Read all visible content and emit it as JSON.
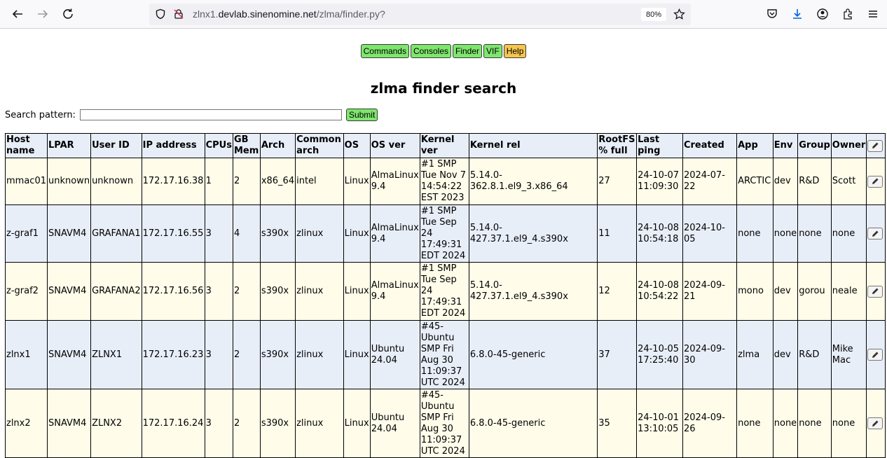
{
  "browser": {
    "url_prefix": "zlnx1.",
    "url_host": "devlab.sinenomine.net",
    "url_path": "/zlma/finder.py?",
    "zoom": "80%"
  },
  "nav": {
    "items": [
      {
        "label": "Commands"
      },
      {
        "label": "Consoles"
      },
      {
        "label": "Finder"
      },
      {
        "label": "VIF"
      },
      {
        "label": "Help"
      }
    ]
  },
  "page": {
    "title": "zlma finder search",
    "search_label": "Search pattern:",
    "search_value": "",
    "submit_label": "Submit"
  },
  "table": {
    "headers": [
      "Host name",
      "LPAR",
      "User ID",
      "IP address",
      "CPUs",
      "GB Mem",
      "Arch",
      "Common arch",
      "OS",
      "OS ver",
      "Kernel ver",
      "Kernel rel",
      "RootFS % full",
      "Last ping",
      "Created",
      "App",
      "Env",
      "Group",
      "Owner"
    ],
    "rows": [
      [
        "mmac01",
        "unknown",
        "unknown",
        "172.17.16.38",
        "1",
        "2",
        "x86_64",
        "intel",
        "Linux",
        "AlmaLinux 9.4",
        "#1 SMP Tue Nov 7 14:54:22 EST 2023",
        "5.14.0-362.8.1.el9_3.x86_64",
        "27",
        "24-10-07 11:09:30",
        "2024-07-22",
        "ARCTIC",
        "dev",
        "R&D",
        "Scott"
      ],
      [
        "z-graf1",
        "SNAVM4",
        "GRAFANA1",
        "172.17.16.55",
        "3",
        "4",
        "s390x",
        "zlinux",
        "Linux",
        "AlmaLinux 9.4",
        "#1 SMP Tue Sep 24 17:49:31 EDT 2024",
        "5.14.0-427.37.1.el9_4.s390x",
        "11",
        "24-10-08 10:54:18",
        "2024-10-05",
        "none",
        "none",
        "none",
        "none"
      ],
      [
        "z-graf2",
        "SNAVM4",
        "GRAFANA2",
        "172.17.16.56",
        "3",
        "2",
        "s390x",
        "zlinux",
        "Linux",
        "AlmaLinux 9.4",
        "#1 SMP Tue Sep 24 17:49:31 EDT 2024",
        "5.14.0-427.37.1.el9_4.s390x",
        "12",
        "24-10-08 10:54:22",
        "2024-09-21",
        "mono",
        "dev",
        "gorou",
        "neale"
      ],
      [
        "zlnx1",
        "SNAVM4",
        "ZLNX1",
        "172.17.16.23",
        "3",
        "2",
        "s390x",
        "zlinux",
        "Linux",
        "Ubuntu 24.04",
        "#45-Ubuntu SMP Fri Aug 30 11:09:37 UTC 2024",
        "6.8.0-45-generic",
        "37",
        "24-10-05 17:25:40",
        "2024-09-30",
        "zlma",
        "dev",
        "R&D",
        "Mike Mac"
      ],
      [
        "zlnx2",
        "SNAVM4",
        "ZLNX2",
        "172.17.16.24",
        "3",
        "2",
        "s390x",
        "zlinux",
        "Linux",
        "Ubuntu 24.04",
        "#45-Ubuntu SMP Fri Aug 30 11:09:37 UTC 2024",
        "6.8.0-45-generic",
        "35",
        "24-10-01 13:10:05",
        "2024-09-26",
        "none",
        "none",
        "none",
        "none"
      ]
    ]
  }
}
